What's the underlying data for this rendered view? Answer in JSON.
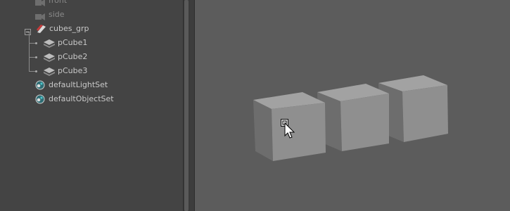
{
  "outliner": {
    "items": [
      {
        "label": "front"
      },
      {
        "label": "side"
      },
      {
        "label": "cubes_grp"
      },
      {
        "label": "pCube1"
      },
      {
        "label": "pCube2"
      },
      {
        "label": "pCube3"
      },
      {
        "label": "defaultLightSet"
      },
      {
        "label": "defaultObjectSet"
      }
    ]
  },
  "icons": {
    "camera": "camera-icon",
    "group": "group-icon",
    "mesh": "mesh-icon",
    "set": "set-icon",
    "collapse": "collapse-icon"
  },
  "colors": {
    "panel_bg": "#444444",
    "viewport_bg": "#5c5c5c",
    "text": "#c8c8c8",
    "cube_front": "#8f8f8f",
    "cube_top": "#a2a2a2",
    "cube_side": "#6f6f6f"
  }
}
